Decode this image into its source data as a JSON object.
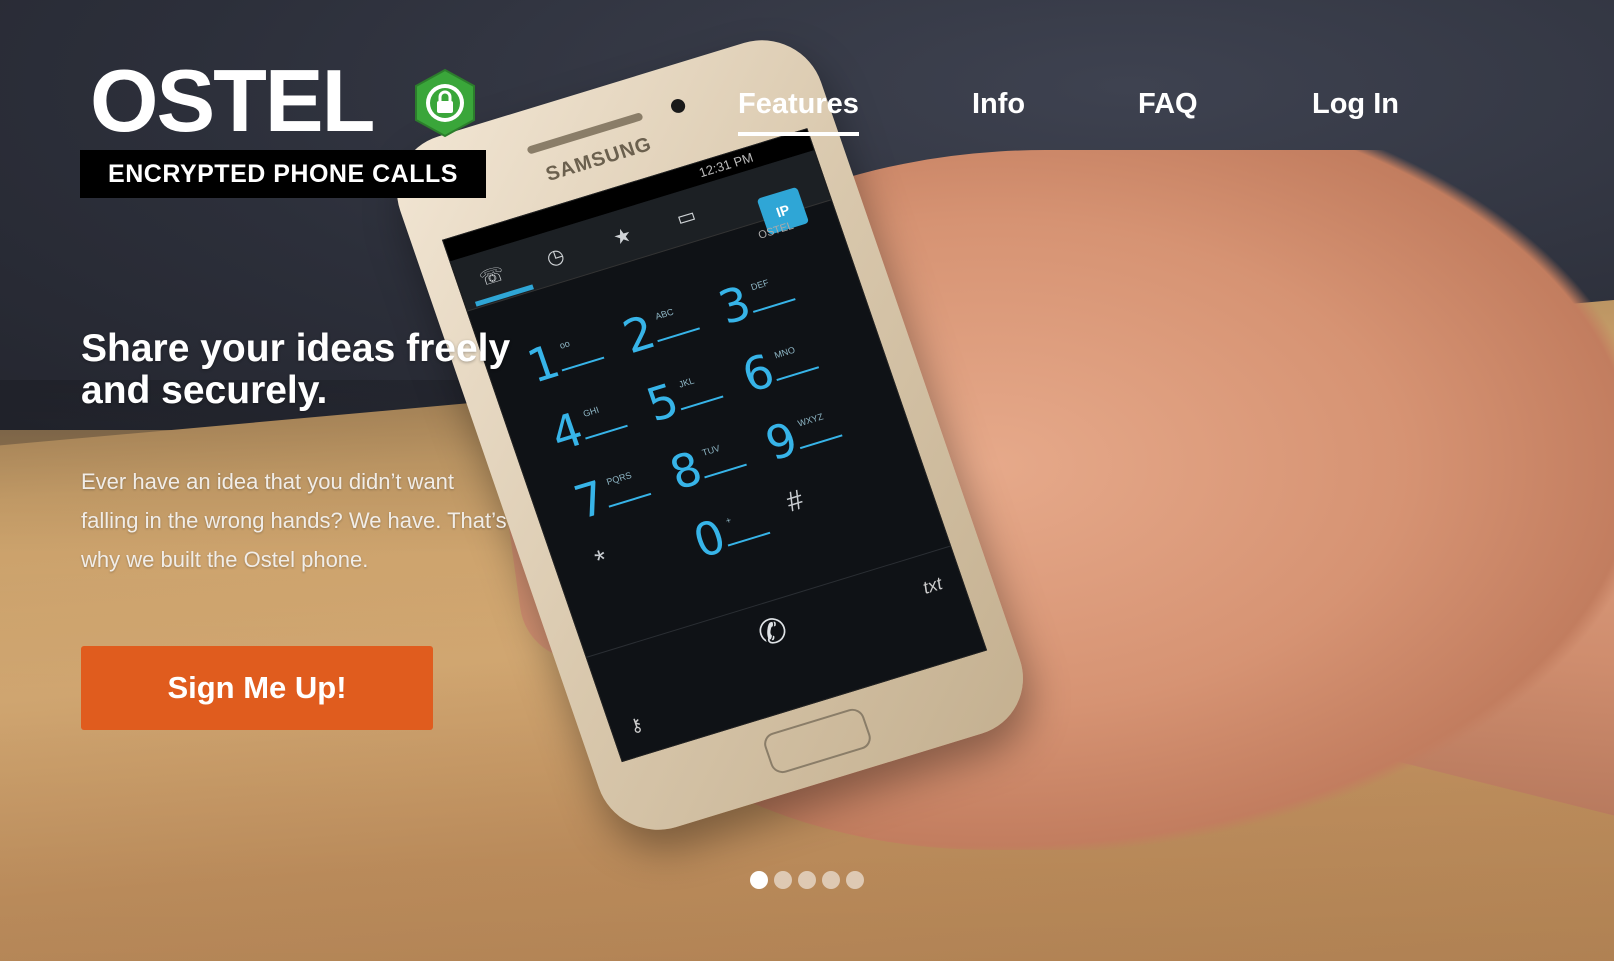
{
  "logo": {
    "wordmark": "OSTEL",
    "tagline": "ENCRYPTED PHONE CALLS",
    "hex_color": "#3aa63a"
  },
  "nav": {
    "items": [
      {
        "label": "Features",
        "active": true
      },
      {
        "label": "Info",
        "active": false
      },
      {
        "label": "FAQ",
        "active": false
      },
      {
        "label": "Log In",
        "active": false
      }
    ]
  },
  "hero": {
    "headline": "Share your ideas freely and securely.",
    "body": "Ever have an idea that you didn’t want falling in the wrong hands? We have. That’s why we built the Ostel phone.",
    "cta_label": "Sign Me Up!",
    "cta_color": "#e05c1e"
  },
  "phone": {
    "brand": "SAMSUNG",
    "status_time": "12:31 PM",
    "ip_badge": "IP",
    "app_brand": "OSTEL",
    "keys": [
      {
        "digit": "1",
        "letters": "oo"
      },
      {
        "digit": "2",
        "letters": "ABC"
      },
      {
        "digit": "3",
        "letters": "DEF"
      },
      {
        "digit": "4",
        "letters": "GHI"
      },
      {
        "digit": "5",
        "letters": "JKL"
      },
      {
        "digit": "6",
        "letters": "MNO"
      },
      {
        "digit": "7",
        "letters": "PQRS"
      },
      {
        "digit": "8",
        "letters": "TUV"
      },
      {
        "digit": "9",
        "letters": "WXYZ"
      },
      {
        "digit": "*",
        "letters": ""
      },
      {
        "digit": "0",
        "letters": "+"
      },
      {
        "digit": "#",
        "letters": ""
      }
    ],
    "txt_label": "txt"
  },
  "carousel": {
    "count": 5,
    "active_index": 0
  },
  "colors": {
    "accent": "#e05c1e",
    "dialpad": "#37b4e8",
    "logo_green": "#3aa63a"
  }
}
